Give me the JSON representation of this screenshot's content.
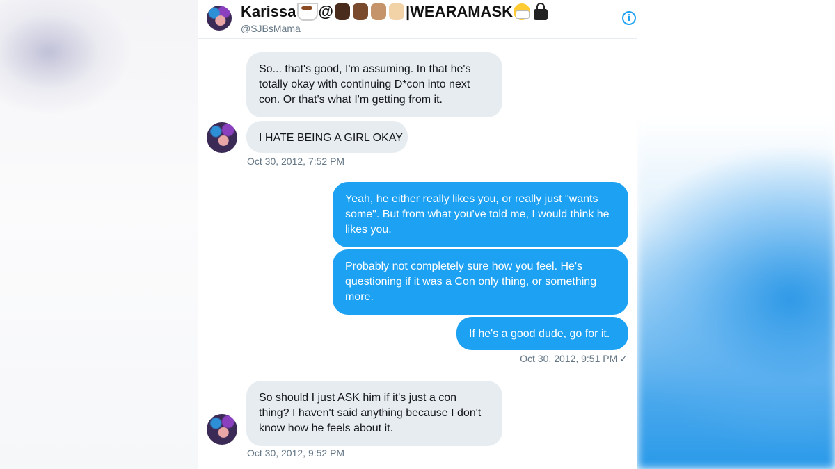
{
  "conversation": {
    "contact_name": "Karissa",
    "contact_name_suffix": "|WEARAMASK",
    "at_symbol": "@",
    "handle": "@SJBsMama",
    "info_icon_glyph": "i",
    "emoji_icons": [
      "hot-beverage-icon",
      "raised-fist-dark-icon",
      "raised-fist-medium-dark-icon",
      "raised-fist-medium-icon",
      "raised-fist-light-icon",
      "face-with-mask-icon",
      "lock-icon"
    ]
  },
  "messages": [
    {
      "sender": "them",
      "text": "So... that's good, I'm assuming. In that he's totally okay with continuing D*con into next con. Or that's what I'm getting from it."
    },
    {
      "sender": "them",
      "text": "I HATE BEING A GIRL OKAY",
      "timestamp": "Oct 30, 2012, 7:52 PM"
    },
    {
      "sender": "me",
      "text": "Yeah, he either really likes you, or really just \"wants some\".  But from what you've told me, I would think he likes you."
    },
    {
      "sender": "me",
      "text": "Probably not completely sure how you feel.  He's questioning if it was a Con only thing, or something more."
    },
    {
      "sender": "me",
      "text": "If he's a good dude, go for it.",
      "timestamp": "Oct 30, 2012, 9:51 PM",
      "read_receipt": "✓"
    },
    {
      "sender": "them",
      "text": "So should I just ASK him if it's just a con thing? I haven't said anything because I don't know how he feels about it.",
      "timestamp": "Oct 30, 2012, 9:52 PM"
    }
  ],
  "colors": {
    "outgoing_bubble": "#1da1f2",
    "incoming_bubble": "#e6ecf0",
    "accent": "#1da1f2",
    "meta_text": "#657786"
  }
}
